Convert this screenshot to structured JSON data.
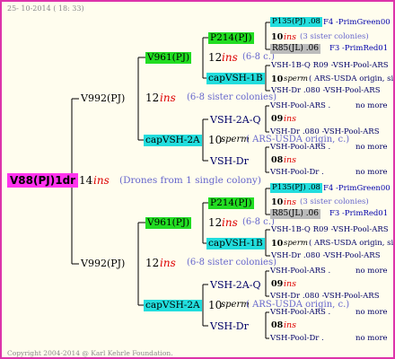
{
  "header": {
    "date": "25- 10-2014 ( 18: 33)"
  },
  "footer": {
    "copyright": "Copyright 2004-2014 @ Karl Kehrle Foundation."
  },
  "root": {
    "label": "V88(PJ)1dr",
    "num": "14",
    "ins": "ins",
    "note": "(Drones from 1 single colony)"
  },
  "upper": {
    "v992": "V992(PJ)",
    "num": "12",
    "ins": "ins",
    "sis": "(6-8 sister colonies)",
    "v961": {
      "label": "V961(PJ)",
      "num": "12",
      "ins": "ins",
      "sis": "(6-8 c.)",
      "p214": {
        "label": "P214(PJ)",
        "num": "10",
        "ins": "ins",
        "sis": "(3 sister colonies)",
        "p135": "P135(PJ) .08",
        "f4": "F4 -PrimGreen00",
        "r85": "R85(JL) .06",
        "f3": "F3 -PrimRed01"
      },
      "capvsh1b": {
        "label": "capVSH-1B",
        "num": "10",
        "sperm": "sperm",
        "note": "( ARS-USDA origin, siste",
        "top": "VSH-1B-Q R09 -VSH-Pool-ARS",
        "bot": "VSH-Dr .080 -VSH-Pool-ARS"
      }
    },
    "capvsh2a": {
      "label": "capVSH-2A",
      "num": "10",
      "sperm": "sperm",
      "note": "( ARS-USDA origin, c.)",
      "vsh2aq": {
        "label": "VSH-2A-Q",
        "num": "09",
        "ins": "ins",
        "top": "VSH-Pool-ARS .",
        "top_more": "no more",
        "bot": "VSH-Dr .080 -VSH-Pool-ARS"
      },
      "vshdr": {
        "label": "VSH-Dr",
        "num": "08",
        "ins": "ins",
        "top": "VSH-Pool-ARS .",
        "top_more": "no more",
        "bot": "VSH-Pool-Dr .",
        "bot_more": "no more"
      }
    }
  },
  "lower": {
    "v992": "V992(PJ)",
    "num": "12",
    "ins": "ins",
    "sis": "(6-8 sister colonies)",
    "v961": {
      "label": "V961(PJ)",
      "num": "12",
      "ins": "ins",
      "sis": "(6-8 c.)",
      "p214": {
        "label": "P214(PJ)",
        "num": "10",
        "ins": "ins",
        "sis": "(3 sister colonies)",
        "p135": "P135(PJ) .08",
        "f4": "F4 -PrimGreen00",
        "r85": "R85(JL) .06",
        "f3": "F3 -PrimRed01"
      },
      "capvsh1b": {
        "label": "capVSH-1B",
        "num": "10",
        "sperm": "sperm",
        "note": "( ARS-USDA origin, siste",
        "top": "VSH-1B-Q R09 -VSH-Pool-ARS",
        "bot": "VSH-Dr .080 -VSH-Pool-ARS"
      }
    },
    "capvsh2a": {
      "label": "capVSH-2A",
      "num": "10",
      "sperm": "sperm",
      "note": "( ARS-USDA origin, c.)",
      "vsh2aq": {
        "label": "VSH-2A-Q",
        "num": "09",
        "ins": "ins",
        "top": "VSH-Pool-ARS .",
        "top_more": "no more",
        "bot": "VSH-Dr .080 -VSH-Pool-ARS"
      },
      "vshdr": {
        "label": "VSH-Dr",
        "num": "08",
        "ins": "ins",
        "top": "VSH-Pool-ARS .",
        "top_more": "no more",
        "bot": "VSH-Pool-Dr .",
        "bot_more": "no more"
      }
    }
  }
}
